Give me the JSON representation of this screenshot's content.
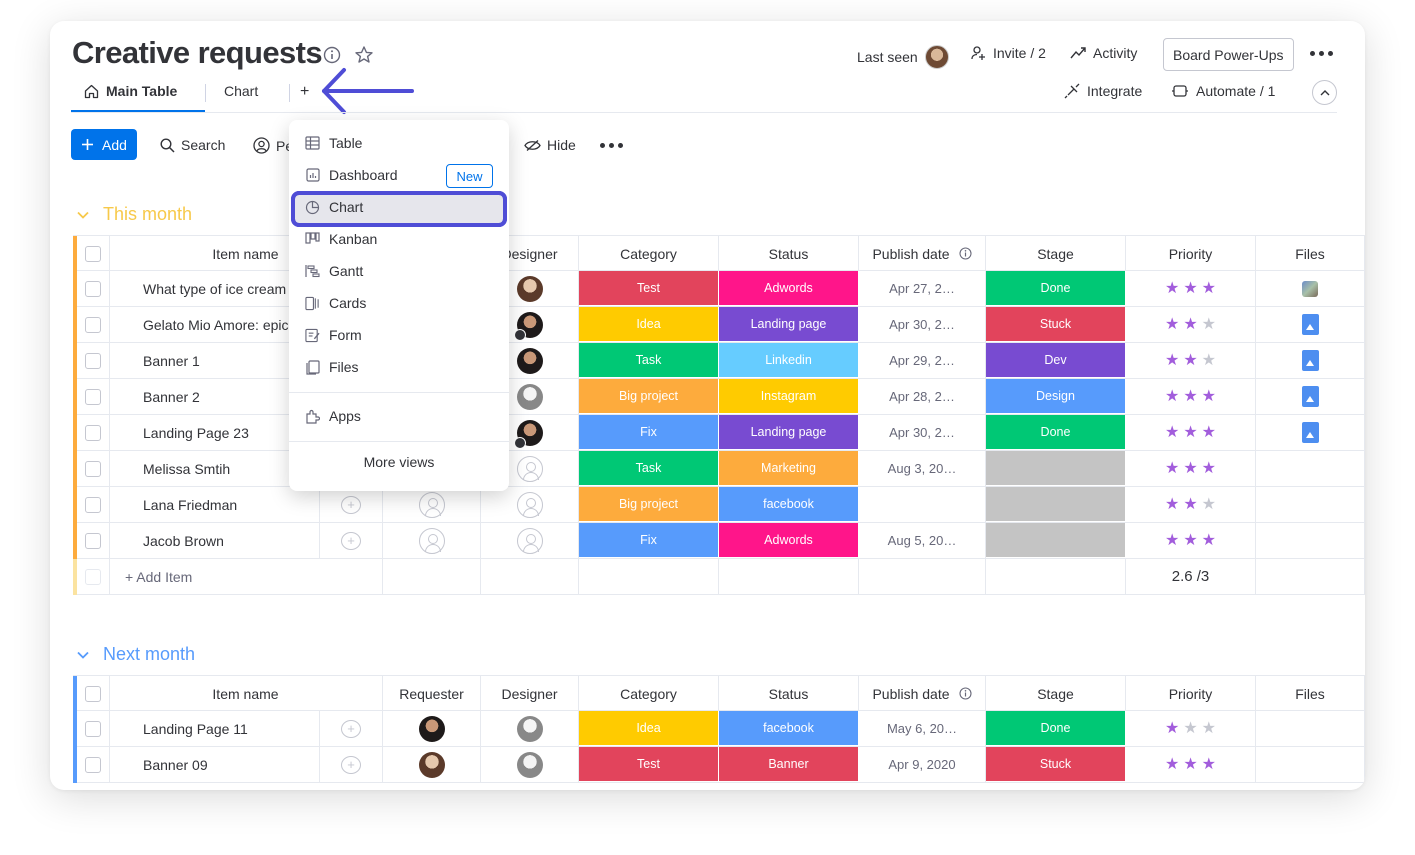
{
  "header": {
    "title": "Creative requests",
    "last_seen_label": "Last seen",
    "invite_label": "Invite / 2",
    "activity_label": "Activity",
    "powerups_label": "Board Power-Ups",
    "integrate_label": "Integrate",
    "automate_label": "Automate / 1"
  },
  "tabs": {
    "main": "Main Table",
    "chart": "Chart",
    "add": "+"
  },
  "toolbar": {
    "add_label": "Add",
    "search_label": "Search",
    "person_label": "Pe",
    "hide_label": "Hide"
  },
  "menu": {
    "items": [
      "Table",
      "Dashboard",
      "Chart",
      "Kanban",
      "Gantt",
      "Cards",
      "Form",
      "Files"
    ],
    "new_badge": "New",
    "apps": "Apps",
    "more_views": "More views",
    "selected": "Chart",
    "highlight_color": "#4f4dd6"
  },
  "columns": {
    "item_name": "Item name",
    "requester": "Requester",
    "designer": "Designer",
    "category": "Category",
    "status": "Status",
    "publish_date": "Publish date",
    "stage": "Stage",
    "priority": "Priority",
    "files": "Files"
  },
  "groups": [
    {
      "title": "This month",
      "color": "#fdab3d",
      "title_color": "#f7c94a",
      "rows": [
        {
          "name": "What type of ice cream",
          "category": "Test",
          "category_color": "#e2445c",
          "status": "Adwords",
          "status_color": "#ff158a",
          "date": "Apr 27, 2…",
          "stage": "Done",
          "stage_color": "#00c875",
          "priority": 3,
          "file": "thumb"
        },
        {
          "name": "Gelato Mio Amore: epic",
          "category": "Idea",
          "category_color": "#ffcb00",
          "status": "Landing page",
          "status_color": "#784bd1",
          "date": "Apr 30, 2…",
          "stage": "Stuck",
          "stage_color": "#e2445c",
          "priority": 2,
          "file": "doc"
        },
        {
          "name": "Banner 1",
          "category": "Task",
          "category_color": "#00c875",
          "status": "Linkedin",
          "status_color": "#66ccff",
          "date": "Apr 29, 2…",
          "stage": "Dev",
          "stage_color": "#784bd1",
          "priority": 2,
          "file": "doc"
        },
        {
          "name": "Banner 2",
          "category": "Big project",
          "category_color": "#fdab3d",
          "status": "Instagram",
          "status_color": "#ffcb00",
          "date": "Apr 28, 2…",
          "stage": "Design",
          "stage_color": "#579bfc",
          "priority": 3,
          "file": "doc"
        },
        {
          "name": "Landing Page 23",
          "category": "Fix",
          "category_color": "#579bfc",
          "status": "Landing page",
          "status_color": "#784bd1",
          "date": "Apr 30, 2…",
          "stage": "Done",
          "stage_color": "#00c875",
          "priority": 3,
          "file": "doc"
        },
        {
          "name": "Melissa Smtih",
          "category": "Task",
          "category_color": "#00c875",
          "status": "Marketing",
          "status_color": "#fdab3d",
          "date": "Aug 3, 20…",
          "stage": "",
          "stage_color": "#c4c4c4",
          "priority": 3,
          "file": ""
        },
        {
          "name": "Lana Friedman",
          "category": "Big project",
          "category_color": "#fdab3d",
          "status": "facebook",
          "status_color": "#579bfc",
          "date": "",
          "stage": "",
          "stage_color": "#c4c4c4",
          "priority": 2,
          "file": ""
        },
        {
          "name": "Jacob Brown",
          "category": "Fix",
          "category_color": "#579bfc",
          "status": "Adwords",
          "status_color": "#ff158a",
          "date": "Aug 5, 20…",
          "stage": "",
          "stage_color": "#c4c4c4",
          "priority": 3,
          "file": ""
        }
      ],
      "add_item": "+ Add Item",
      "priority_summary": "2.6 /3"
    },
    {
      "title": "Next month",
      "color": "#579bfc",
      "title_color": "#579bfc",
      "rows": [
        {
          "name": "Landing Page 11",
          "category": "Idea",
          "category_color": "#ffcb00",
          "status": "facebook",
          "status_color": "#579bfc",
          "date": "May 6, 20…",
          "stage": "Done",
          "stage_color": "#00c875",
          "priority": 1,
          "file": ""
        },
        {
          "name": "Banner 09",
          "category": "Test",
          "category_color": "#e2445c",
          "status": "Banner",
          "status_color": "#e2445c",
          "date": "Apr 9, 2020",
          "stage": "Stuck",
          "stage_color": "#e2445c",
          "priority": 3,
          "file": ""
        }
      ]
    }
  ]
}
